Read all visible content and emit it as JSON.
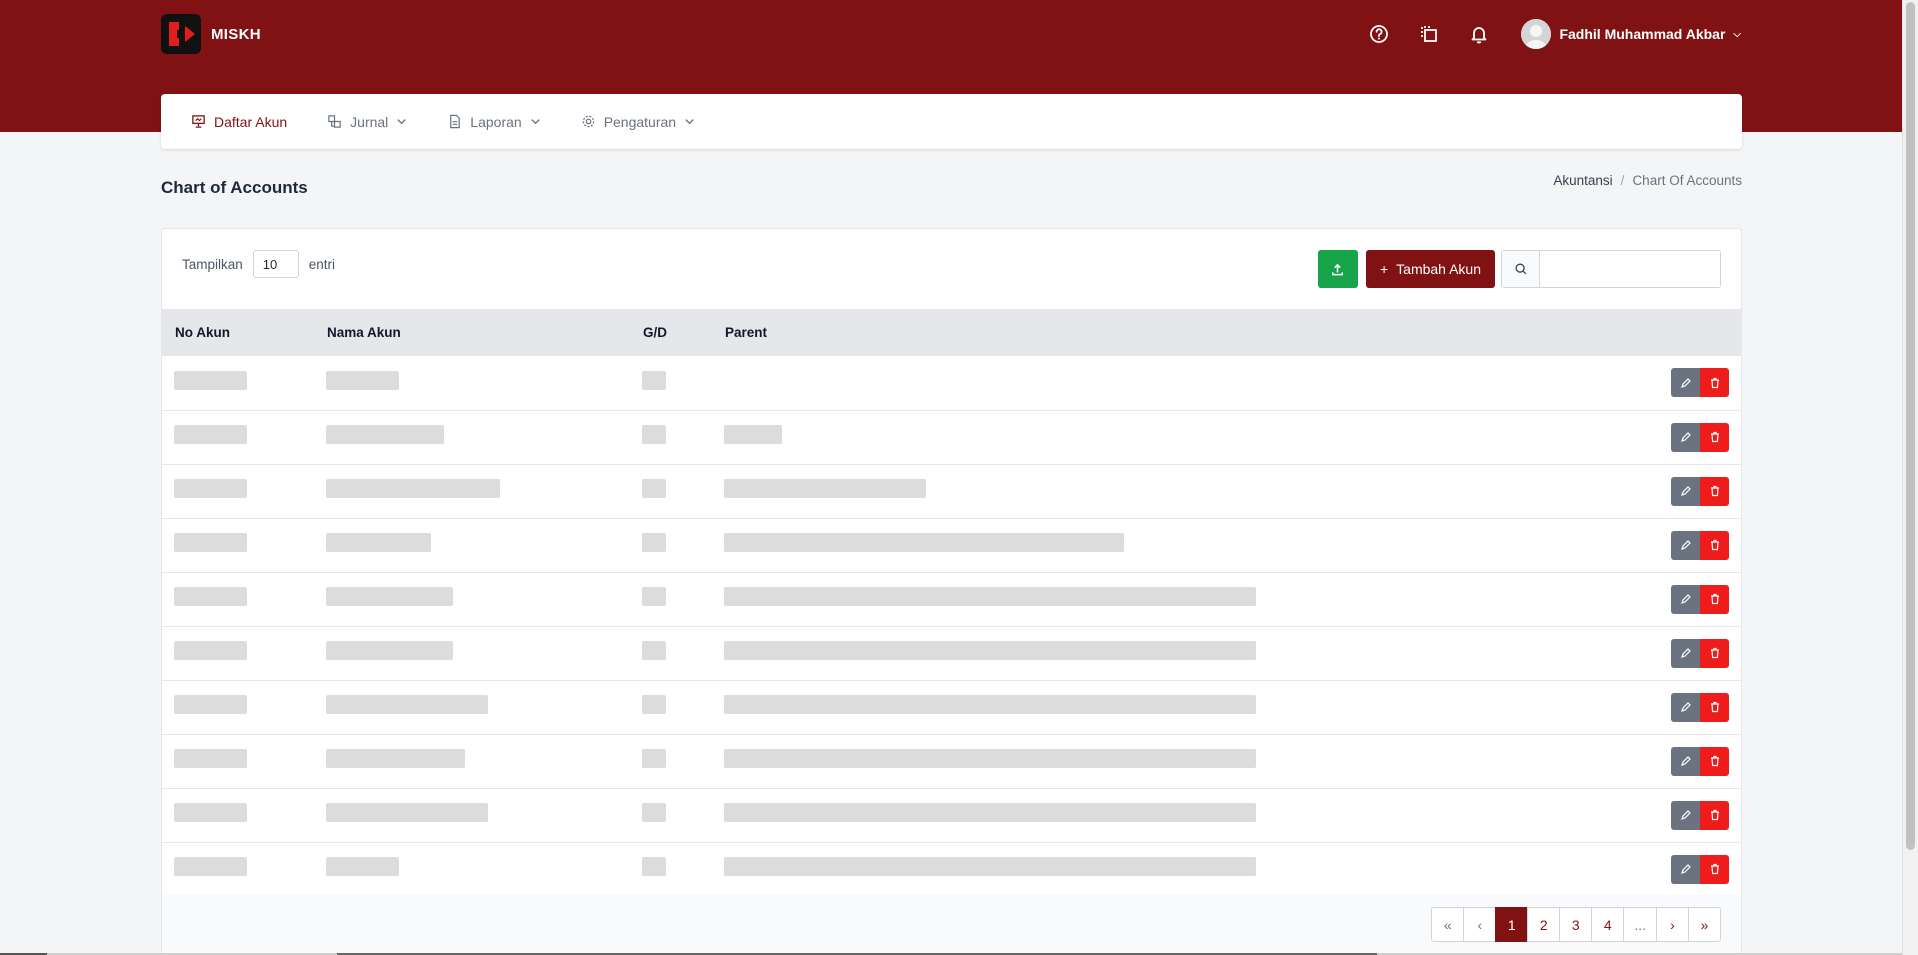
{
  "app": {
    "name": "MISKH"
  },
  "user": {
    "name": "Fadhil Muhammad Akbar"
  },
  "nav": {
    "items": [
      {
        "label": "Daftar Akun",
        "active": true
      },
      {
        "label": "Jurnal"
      },
      {
        "label": "Laporan"
      },
      {
        "label": "Pengaturan"
      }
    ]
  },
  "page": {
    "title": "Chart of Accounts",
    "breadcrumb": [
      "Akuntansi",
      "/",
      "Chart Of Accounts"
    ]
  },
  "toolbar": {
    "show_label": "Tampilkan",
    "entries_value": "10",
    "entries_label": "entri",
    "add_label": "Tambah Akun",
    "search_value": ""
  },
  "table": {
    "columns": [
      "No Akun",
      "Nama Akun",
      "G/D",
      "Parent"
    ]
  },
  "pagination": {
    "first": "«",
    "prev": "‹",
    "pages": [
      "1",
      "2",
      "3",
      "4",
      "..."
    ],
    "current": "1",
    "next": "›",
    "last": "»"
  },
  "colors": {
    "brand": "#811214",
    "export": "#16a34a",
    "delete": "#ef1c1c",
    "edit": "#6b7280"
  }
}
